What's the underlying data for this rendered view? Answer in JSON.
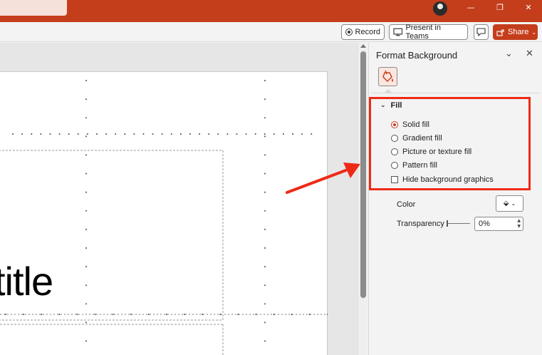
{
  "titlebar": {
    "minimize_glyph": "—",
    "restore_glyph": "❐",
    "close_glyph": "✕"
  },
  "toolbar": {
    "record_label": "Record",
    "present_label": "Present in Teams",
    "share_label": "Share"
  },
  "slide": {
    "title_partial": "title"
  },
  "pane": {
    "title": "Format Background",
    "section": {
      "label": "Fill",
      "options": [
        {
          "label": "Solid fill",
          "selected": true
        },
        {
          "label": "Gradient fill",
          "selected": false
        },
        {
          "label": "Picture or texture fill",
          "selected": false
        },
        {
          "label": "Pattern fill",
          "selected": false
        }
      ],
      "checkbox": {
        "label": "Hide background graphics",
        "checked": false
      }
    },
    "color_label": "Color",
    "transparency_label": "Transparency",
    "transparency_value": "0%"
  },
  "colors": {
    "brand": "#c43e1c",
    "annotation": "#ee2a16"
  }
}
